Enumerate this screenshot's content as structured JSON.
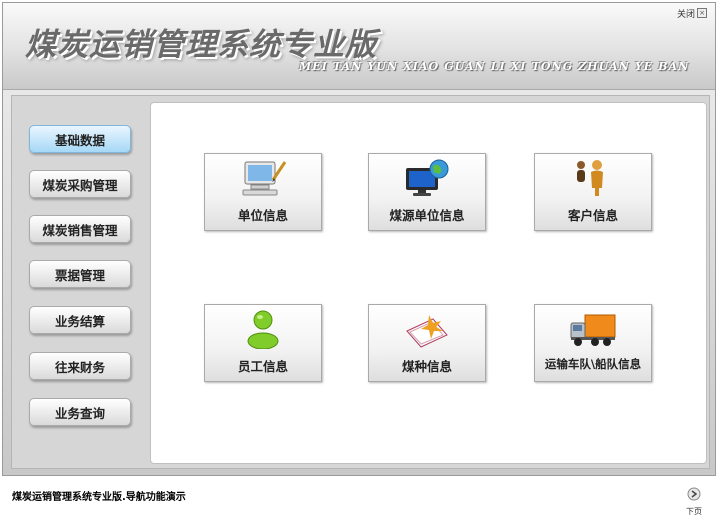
{
  "header": {
    "title_cn": "煤炭运销管理系统专业版",
    "title_en": "MEI TAN YUN XIAO GUAN LI XI TONG ZHUAN YE BAN",
    "close_label": "关闭"
  },
  "sidebar": {
    "items": [
      {
        "label": "基础数据",
        "active": true
      },
      {
        "label": "煤炭采购管理",
        "active": false
      },
      {
        "label": "煤炭销售管理",
        "active": false
      },
      {
        "label": "票据管理",
        "active": false
      },
      {
        "label": "业务结算",
        "active": false
      },
      {
        "label": "往来财务",
        "active": false
      },
      {
        "label": "业务查询",
        "active": false
      }
    ]
  },
  "tiles": [
    {
      "label": "单位信息",
      "icon": "computer-pen-icon"
    },
    {
      "label": "煤源单位信息",
      "icon": "monitor-globe-icon"
    },
    {
      "label": "客户信息",
      "icon": "people-icon"
    },
    {
      "label": "员工信息",
      "icon": "user-icon"
    },
    {
      "label": "煤种信息",
      "icon": "notebook-leaf-icon"
    },
    {
      "label": "运输车队\\船队信息",
      "icon": "truck-icon"
    }
  ],
  "status": {
    "text": "煤炭运销管理系统专业版.导航功能演示",
    "next_label": "下页"
  },
  "colors": {
    "active_button": "#a6d8f6",
    "header_gradient_top": "#fafafa",
    "header_gradient_bottom": "#c9c9c9"
  }
}
